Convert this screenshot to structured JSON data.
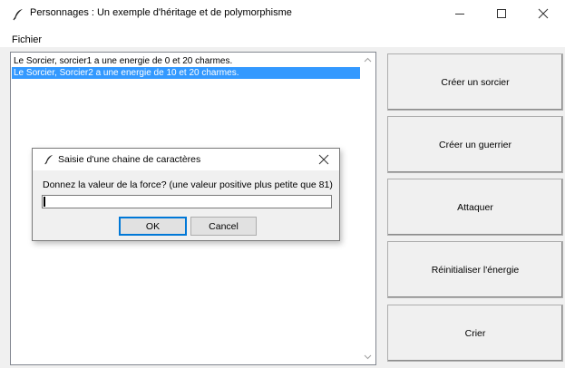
{
  "window": {
    "title": "Personnages : Un exemple d'héritage et de polymorphisme",
    "icon": "feather-icon"
  },
  "menu": {
    "items": [
      "Fichier"
    ]
  },
  "list": {
    "rows": [
      {
        "text": "Le Sorcier, sorcier1 a une energie de 0 et 20 charmes.",
        "selected": false
      },
      {
        "text": "Le Sorcier, Sorcier2 a une energie de 10 et 20 charmes.",
        "selected": true
      }
    ]
  },
  "buttons": [
    "Créer un sorcier",
    "Créer un guerrier",
    "Attaquer",
    "Réinitialiser l'énergie",
    "Crier"
  ],
  "dialog": {
    "title": "Saisie d'une chaine de caractères",
    "prompt": "Donnez la valeur de la force? (une valeur positive plus petite que 81)",
    "input_value": "",
    "ok_label": "OK",
    "cancel_label": "Cancel"
  },
  "colors": {
    "selection": "#3399ff",
    "focus_border": "#0078d7"
  }
}
